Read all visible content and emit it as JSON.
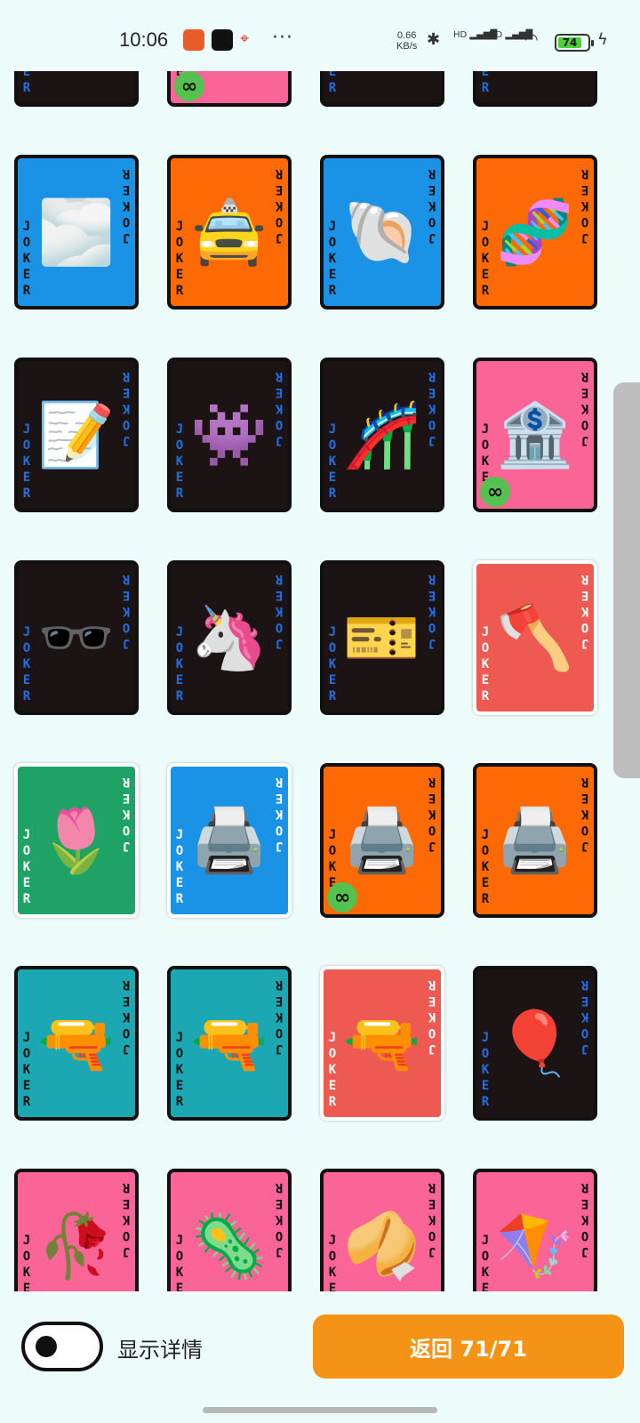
{
  "status": {
    "time": "10:06",
    "net_speed_value": "0.66",
    "net_speed_unit": "KB/s",
    "signal1": "HD",
    "signal2": "HD",
    "battery": "74",
    "dots": "···"
  },
  "joker_text": "JOKER",
  "infinity": "∞",
  "colors": {
    "black": "#1c1414",
    "blue": "#1a93e6",
    "orange": "#fd6a05",
    "pink": "#fb6496",
    "red": "#ee5a52",
    "green": "#1fa266",
    "teal": "#1ca8b3"
  },
  "cards": [
    {
      "emoji": "",
      "bg": "#1c1414",
      "text": "blue",
      "badge": false
    },
    {
      "emoji": "",
      "bg": "#fb6496",
      "text": "dark",
      "badge": true
    },
    {
      "emoji": "",
      "bg": "#1c1414",
      "text": "blue",
      "badge": false
    },
    {
      "emoji": "",
      "bg": "#1c1414",
      "text": "blue",
      "badge": false
    },
    {
      "emoji": "🌫️",
      "bg": "#1a93e6",
      "text": "dark",
      "badge": false
    },
    {
      "emoji": "🚖",
      "bg": "#fd6a05",
      "text": "dark",
      "badge": false
    },
    {
      "emoji": "🐚",
      "bg": "#1a93e6",
      "text": "dark",
      "badge": false
    },
    {
      "emoji": "🧬",
      "bg": "#fd6a05",
      "text": "dark",
      "badge": false
    },
    {
      "emoji": "📝",
      "bg": "#1c1414",
      "text": "blue",
      "badge": false
    },
    {
      "emoji": "👾",
      "bg": "#1c1414",
      "text": "blue",
      "badge": false
    },
    {
      "emoji": "🎢",
      "bg": "#1c1414",
      "text": "blue",
      "badge": false
    },
    {
      "emoji": "🏦",
      "bg": "#fb6496",
      "text": "dark",
      "badge": true
    },
    {
      "emoji": "🕶️",
      "bg": "#1c1414",
      "text": "blue",
      "badge": false
    },
    {
      "emoji": "🦄",
      "bg": "#1c1414",
      "text": "blue",
      "badge": false
    },
    {
      "emoji": "🎫",
      "bg": "#1c1414",
      "text": "blue",
      "badge": false
    },
    {
      "emoji": "🪓",
      "bg": "#ee5a52",
      "text": "light",
      "badge": false,
      "white": true
    },
    {
      "emoji": "🌷",
      "bg": "#1fa266",
      "text": "light",
      "badge": false,
      "white": true
    },
    {
      "emoji": "🖨️",
      "bg": "#1a93e6",
      "text": "light",
      "badge": false,
      "white": true
    },
    {
      "emoji": "🖨️",
      "bg": "#fd6a05",
      "text": "dark",
      "badge": true
    },
    {
      "emoji": "🖨️",
      "bg": "#fd6a05",
      "text": "dark",
      "badge": false
    },
    {
      "emoji": "🔫",
      "bg": "#1ca8b3",
      "text": "dark",
      "badge": false
    },
    {
      "emoji": "🔫",
      "bg": "#1ca8b3",
      "text": "dark",
      "badge": false
    },
    {
      "emoji": "🔫",
      "bg": "#ee5a52",
      "text": "light",
      "badge": false,
      "white": true
    },
    {
      "emoji": "🎈",
      "bg": "#1c1414",
      "text": "blue",
      "badge": false
    },
    {
      "emoji": "🥀",
      "bg": "#fb6496",
      "text": "dark",
      "badge": false
    },
    {
      "emoji": "🦠",
      "bg": "#fb6496",
      "text": "dark",
      "badge": false
    },
    {
      "emoji": "🥠",
      "bg": "#fb6496",
      "text": "dark",
      "badge": false
    },
    {
      "emoji": "🪁",
      "bg": "#fb6496",
      "text": "dark",
      "badge": false
    }
  ],
  "bottom": {
    "toggle_label": "显示详情",
    "back_button": "返回 71/71"
  }
}
